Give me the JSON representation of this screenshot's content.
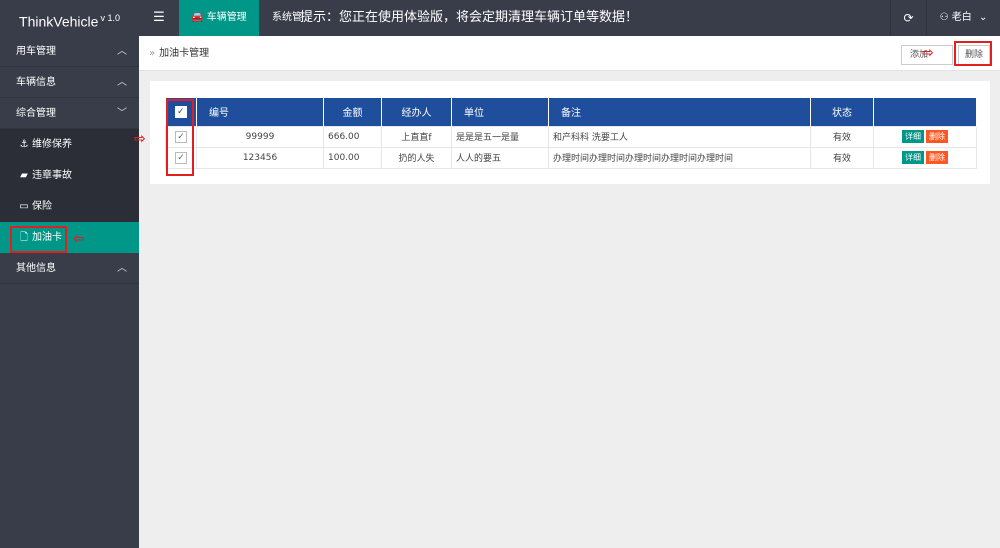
{
  "brand": {
    "name": "ThinkVehicle",
    "version": "v 1.0"
  },
  "topbar": {
    "menu_icon": "hamburger-icon",
    "active_tab": "车辆管理",
    "system_tab": "系统管",
    "notice": "提示：您正在使用体验版，将会定期清理车辆订单等数据！",
    "user_name": "老白"
  },
  "sidebar": {
    "groups": [
      {
        "label": "用车管理",
        "chevron": "^"
      },
      {
        "label": "车辆信息",
        "chevron": "^"
      },
      {
        "label": "综合管理",
        "chevron": "v"
      },
      {
        "label": "其他信息",
        "chevron": "^"
      }
    ],
    "sub_items": [
      {
        "label": "维修保养",
        "icon": "anchor-icon"
      },
      {
        "label": "违章事故",
        "icon": "car-icon"
      },
      {
        "label": "保险",
        "icon": "card-icon"
      },
      {
        "label": "加油卡",
        "icon": "file-icon"
      }
    ]
  },
  "breadcrumb": {
    "label": "加油卡管理"
  },
  "toolbar": {
    "add_label": "添加",
    "delete_label": "删除"
  },
  "table": {
    "headers": [
      "编号",
      "金额",
      "经办人",
      "单位",
      "备注",
      "状态",
      ""
    ],
    "rows": [
      {
        "id": "99999",
        "amount": "666.00",
        "handler": "上直直f",
        "unit": "是是是五一是量",
        "remark": "和产科科 洗要工人",
        "status": "有效"
      },
      {
        "id": "123456",
        "amount": "100.00",
        "handler": "扔的人失",
        "unit": "人人的要五",
        "remark": "办理时间办理时间办理时间办理时间办理时间",
        "status": "有效"
      }
    ],
    "detail_label": "详细",
    "delete_label": "删除"
  },
  "colors": {
    "sidebar": "#393d49",
    "accent": "#009688",
    "table_header": "#1f4e9c",
    "danger": "#ff5722",
    "annotation": "#e02020"
  }
}
